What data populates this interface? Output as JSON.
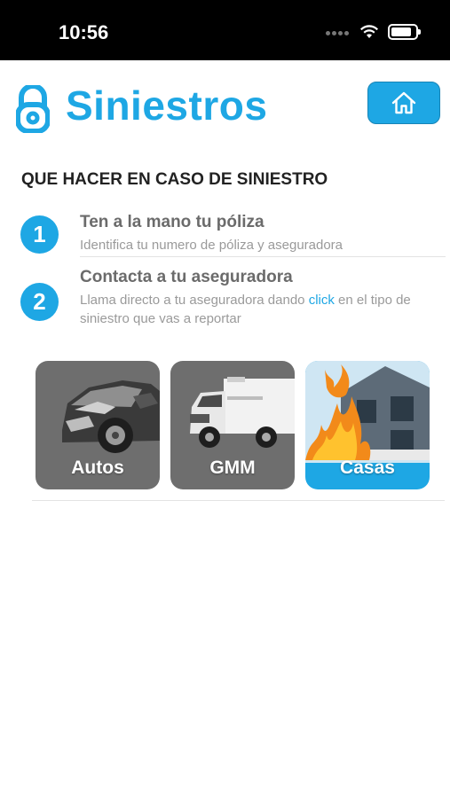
{
  "status_bar": {
    "time": "10:56"
  },
  "header": {
    "title": "Siniestros"
  },
  "section": {
    "heading": "QUE HACER EN CASO DE SINIESTRO"
  },
  "steps": [
    {
      "number": "1",
      "title": "Ten a la mano tu póliza",
      "description": "Identifica tu numero de póliza y aseguradora"
    },
    {
      "number": "2",
      "title": "Contacta a tu aseguradora",
      "description_pre": "Llama directo a tu aseguradora dando ",
      "link_text": "click",
      "description_post": " en el tipo de siniestro que vas a reportar"
    }
  ],
  "cards": [
    {
      "label": "Autos"
    },
    {
      "label": "GMM"
    },
    {
      "label": "Casas"
    }
  ],
  "colors": {
    "accent": "#1ea7e4",
    "card_gray": "#6e6e6e"
  }
}
